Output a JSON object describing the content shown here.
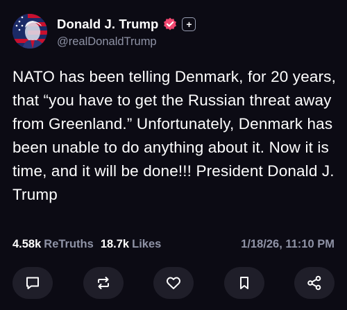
{
  "post": {
    "author": {
      "display_name": "Donald J. Trump",
      "handle": "@realDonaldTrump",
      "verified_icon": "verified-badge-icon",
      "plus_badge": "+"
    },
    "text": "NATO has been telling Denmark, for 20 years, that “you have to get the Russian threat away from Greenland.” Unfortunately, Denmark has been unable to do anything about it. Now it is time, and it will be done!!! President Donald J. Trump",
    "stats": {
      "retruths_count": "4.58k",
      "retruths_label": "ReTruths",
      "likes_count": "18.7k",
      "likes_label": "Likes"
    },
    "timestamp": "1/18/26, 11:10 PM"
  },
  "actions": [
    {
      "name": "reply",
      "icon": "comment-icon"
    },
    {
      "name": "retruth",
      "icon": "repost-icon"
    },
    {
      "name": "like",
      "icon": "heart-icon"
    },
    {
      "name": "bookmark",
      "icon": "bookmark-icon"
    },
    {
      "name": "share",
      "icon": "share-icon"
    }
  ],
  "colors": {
    "background": "#0c0b14",
    "text": "#ffffff",
    "muted": "#8f93a6",
    "verified": "#f0476f",
    "button_bg": "#1f1e29"
  }
}
